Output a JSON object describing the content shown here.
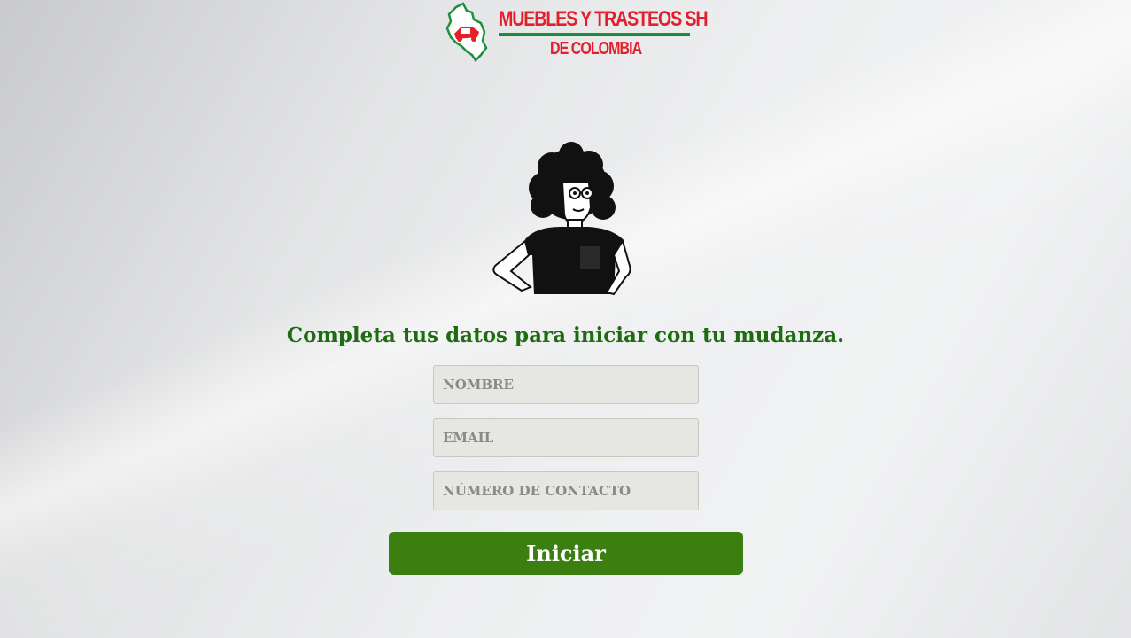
{
  "brand": {
    "name": "MUEBLES Y TRASTEOS SH",
    "subtitle": "DE COLOMBIA",
    "logo_icon": "colombia-map-truck-icon",
    "colors": {
      "red": "#e41e2b",
      "green": "#1e8f3a"
    }
  },
  "illustration": {
    "name": "person-afro-illustration"
  },
  "form": {
    "heading": "Completa tus datos para iniciar con tu mudanza.",
    "fields": [
      {
        "placeholder": "NOMBRE",
        "value": ""
      },
      {
        "placeholder": "EMAIL",
        "value": ""
      },
      {
        "placeholder": "NÚMERO DE CONTACTO",
        "value": ""
      }
    ],
    "submit_label": "Iniciar"
  },
  "colors": {
    "heading": "#1f6b12",
    "button": "#3a7f0f",
    "field_bg": "#e6e7e3"
  }
}
